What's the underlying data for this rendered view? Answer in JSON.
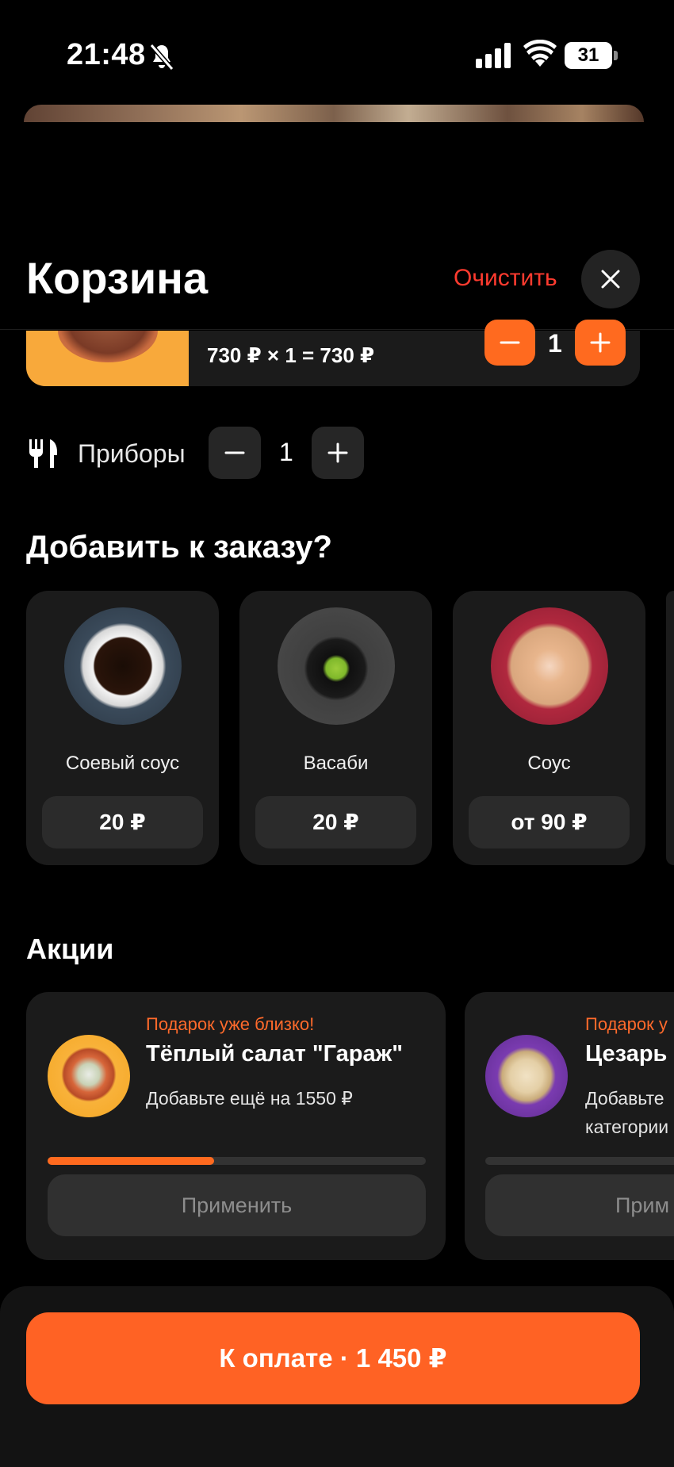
{
  "status_bar": {
    "time": "21:48",
    "battery": "31"
  },
  "header": {
    "title": "Корзина",
    "clear_label": "Очистить"
  },
  "cart_item": {
    "price_line": "730 ₽ × 1 = 730 ₽",
    "quantity": "1"
  },
  "cutlery": {
    "label": "Приборы",
    "count": "1"
  },
  "addons": {
    "title": "Добавить к заказу?",
    "items": [
      {
        "name": "Соевый соус",
        "price": "20 ₽"
      },
      {
        "name": "Васаби",
        "price": "20 ₽"
      },
      {
        "name": "Соус",
        "price": "от 90 ₽"
      }
    ]
  },
  "promos": {
    "title": "Акции",
    "items": [
      {
        "kicker": "Подарок уже близко!",
        "title": "Тёплый салат \"Гараж\"",
        "desc": "Добавьте ещё на 1550 ₽",
        "progress": 0.44,
        "apply_label": "Применить"
      },
      {
        "kicker": "Подарок у",
        "title": "Цезарь",
        "desc": "Добавьте",
        "desc2": "категории",
        "apply_label": "Прим"
      }
    ]
  },
  "checkout": {
    "label": "К оплате · 1 450 ₽"
  },
  "colors": {
    "accent": "#ff6a1f",
    "danger": "#ff3b2f",
    "card": "#1b1b1b",
    "background": "#000000"
  },
  "icons": [
    "bell-muted-icon",
    "signal-icon",
    "wifi-icon",
    "battery-icon",
    "close-icon",
    "minus-icon",
    "plus-icon",
    "cutlery-icon"
  ]
}
